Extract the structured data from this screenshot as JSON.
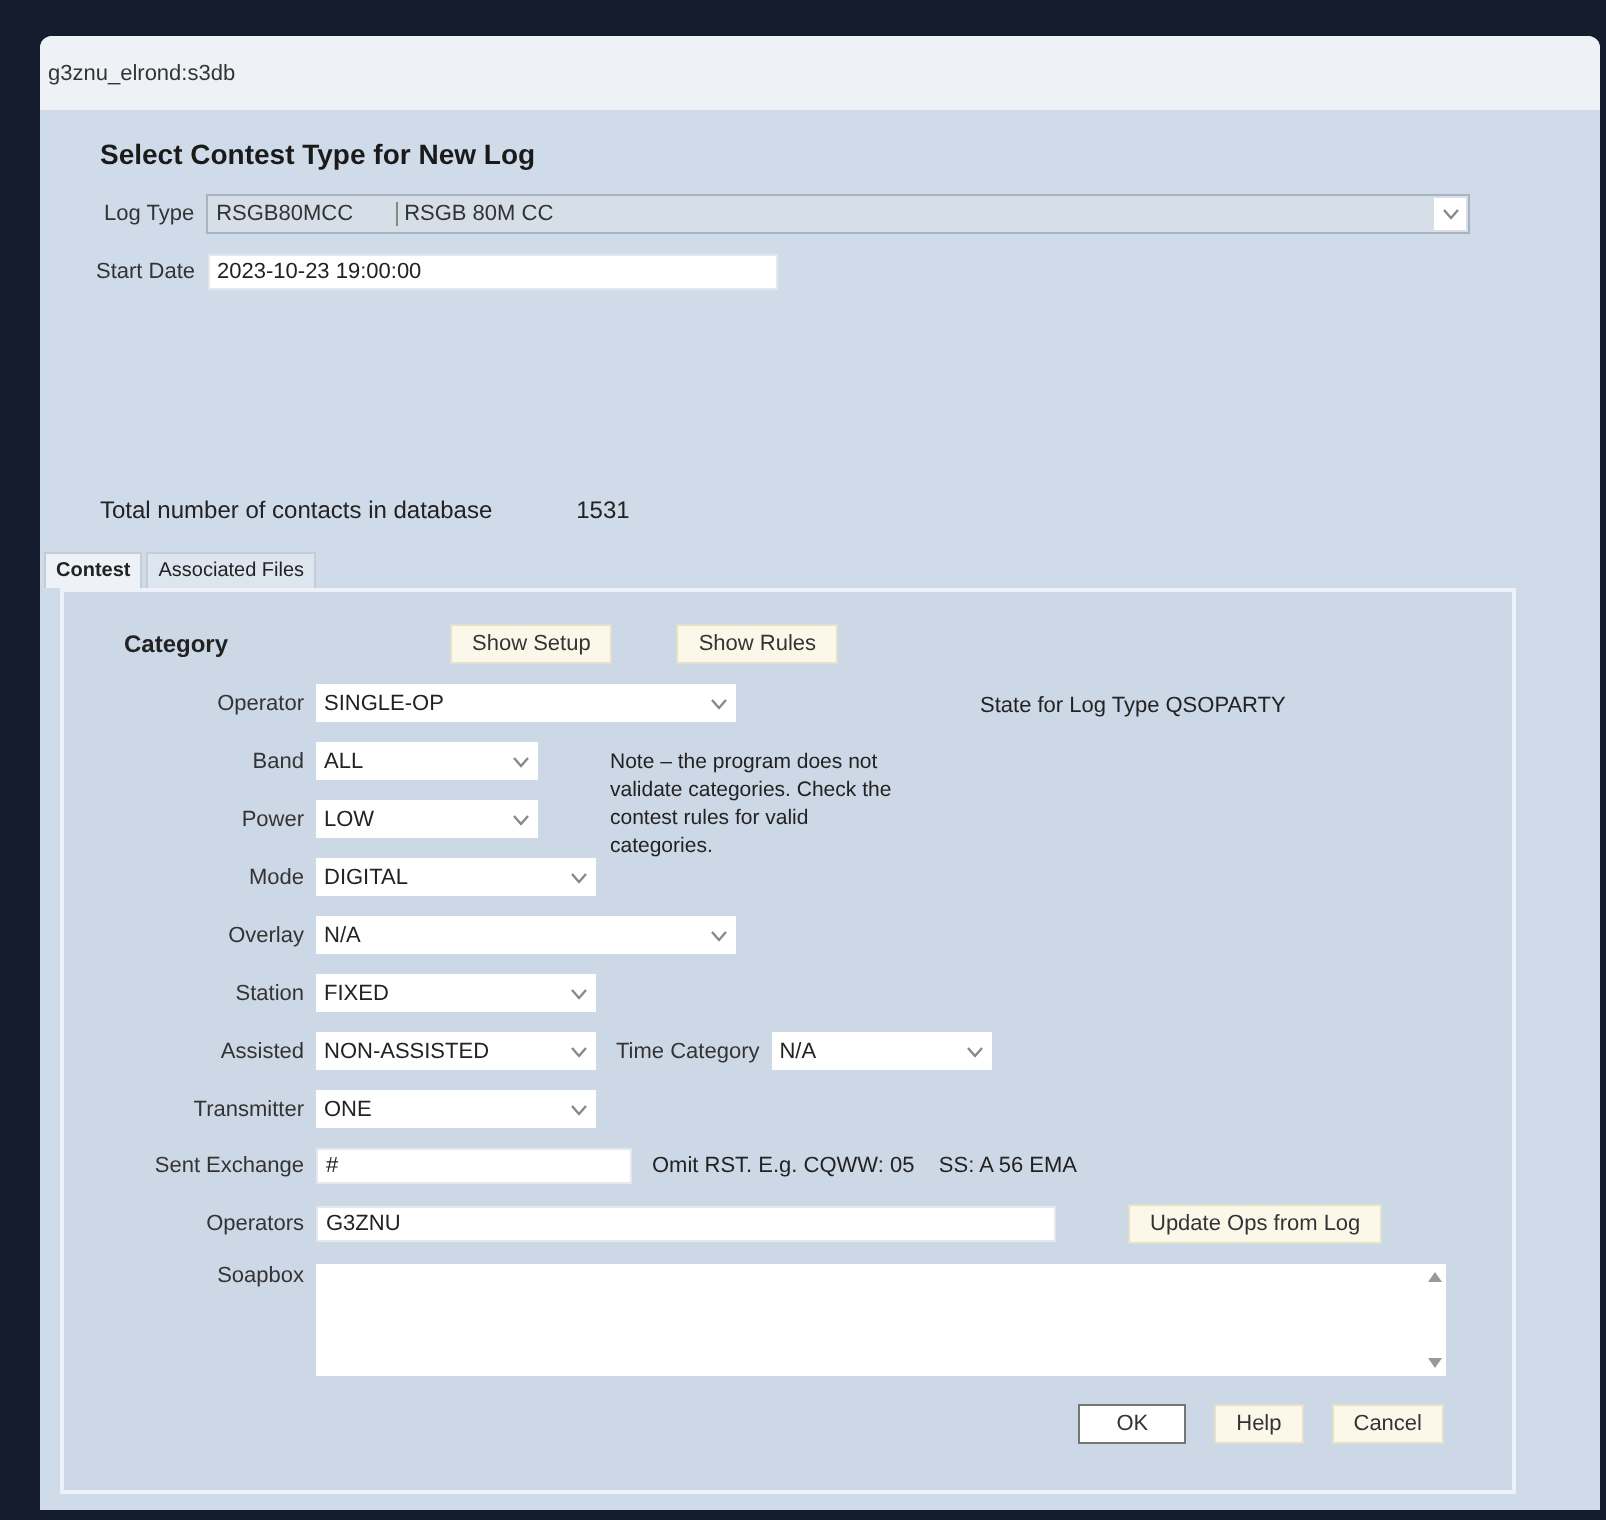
{
  "window": {
    "title": "g3znu_elrond:s3db"
  },
  "heading": "Select Contest Type for New Log",
  "log_type": {
    "label": "Log Type",
    "code": "RSGB80MCC",
    "name": "RSGB 80M CC"
  },
  "start_date": {
    "label": "Start Date",
    "value": "2023-10-23 19:00:00"
  },
  "total": {
    "label": "Total number of contacts in database",
    "value": "1531"
  },
  "tabs": [
    {
      "label": "Contest",
      "selected": true
    },
    {
      "label": "Associated Files",
      "selected": false
    }
  ],
  "category_label": "Category",
  "top_buttons": [
    "Show Setup",
    "Show Rules"
  ],
  "state_note": "State for Log Type QSOPARTY",
  "note": "Note – the program does not validate categories. Check the contest rules for valid categories.",
  "rows": [
    {
      "label": "Operator",
      "kind": "select",
      "value": "SINGLE-OP"
    },
    {
      "label": "Band",
      "kind": "select",
      "value": "ALL"
    },
    {
      "label": "Power",
      "kind": "select",
      "value": "LOW"
    },
    {
      "label": "Mode",
      "kind": "select",
      "value": "DIGITAL"
    },
    {
      "label": "Overlay",
      "kind": "select",
      "value": "N/A"
    },
    {
      "label": "Station",
      "kind": "select",
      "value": "FIXED"
    },
    {
      "label": "Assisted",
      "kind": "select",
      "value": "NON-ASSISTED",
      "extra": {
        "label": "Time Category",
        "value": "N/A"
      }
    },
    {
      "label": "Transmitter",
      "kind": "select",
      "value": "ONE"
    },
    {
      "label": "Sent Exchange",
      "kind": "text",
      "value": "#",
      "hint": "Omit RST. E.g. CQWW: 05    SS: A 56 EMA"
    },
    {
      "label": "Operators",
      "kind": "text",
      "value": "G3ZNU",
      "button": "Update Ops from Log"
    },
    {
      "label": "Soapbox",
      "kind": "textarea"
    }
  ],
  "buttons": [
    {
      "label": "OK",
      "default": true
    },
    {
      "label": "Help",
      "default": false
    },
    {
      "label": "Cancel",
      "default": false
    }
  ]
}
